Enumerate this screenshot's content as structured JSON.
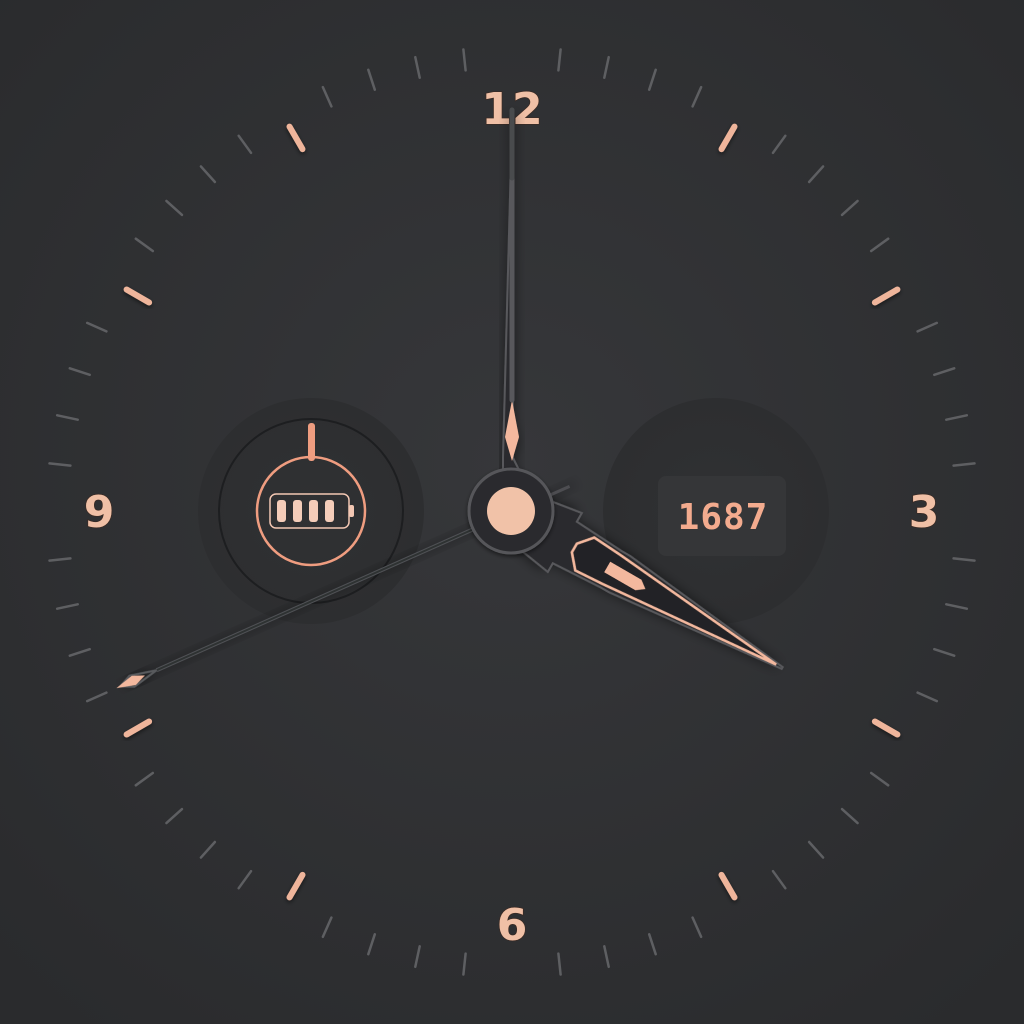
{
  "watch_face": {
    "dial_numerals": {
      "twelve": "12",
      "three": "3",
      "six": "6",
      "nine": "9"
    },
    "time": {
      "hour": 4,
      "minute": 0,
      "second": 41
    },
    "battery_complication": {
      "icon": "battery-icon",
      "level_bars": 4,
      "level_bars_max": 4,
      "progress_fraction": 0
    },
    "steps_complication": {
      "value": "1687"
    },
    "colors": {
      "background": "#2c2d2f",
      "accent": "#f3b89e",
      "accent_dark": "#e99a7c",
      "minor_tick": "#5e5f62",
      "hand_fill": "#2a2b2d"
    }
  }
}
